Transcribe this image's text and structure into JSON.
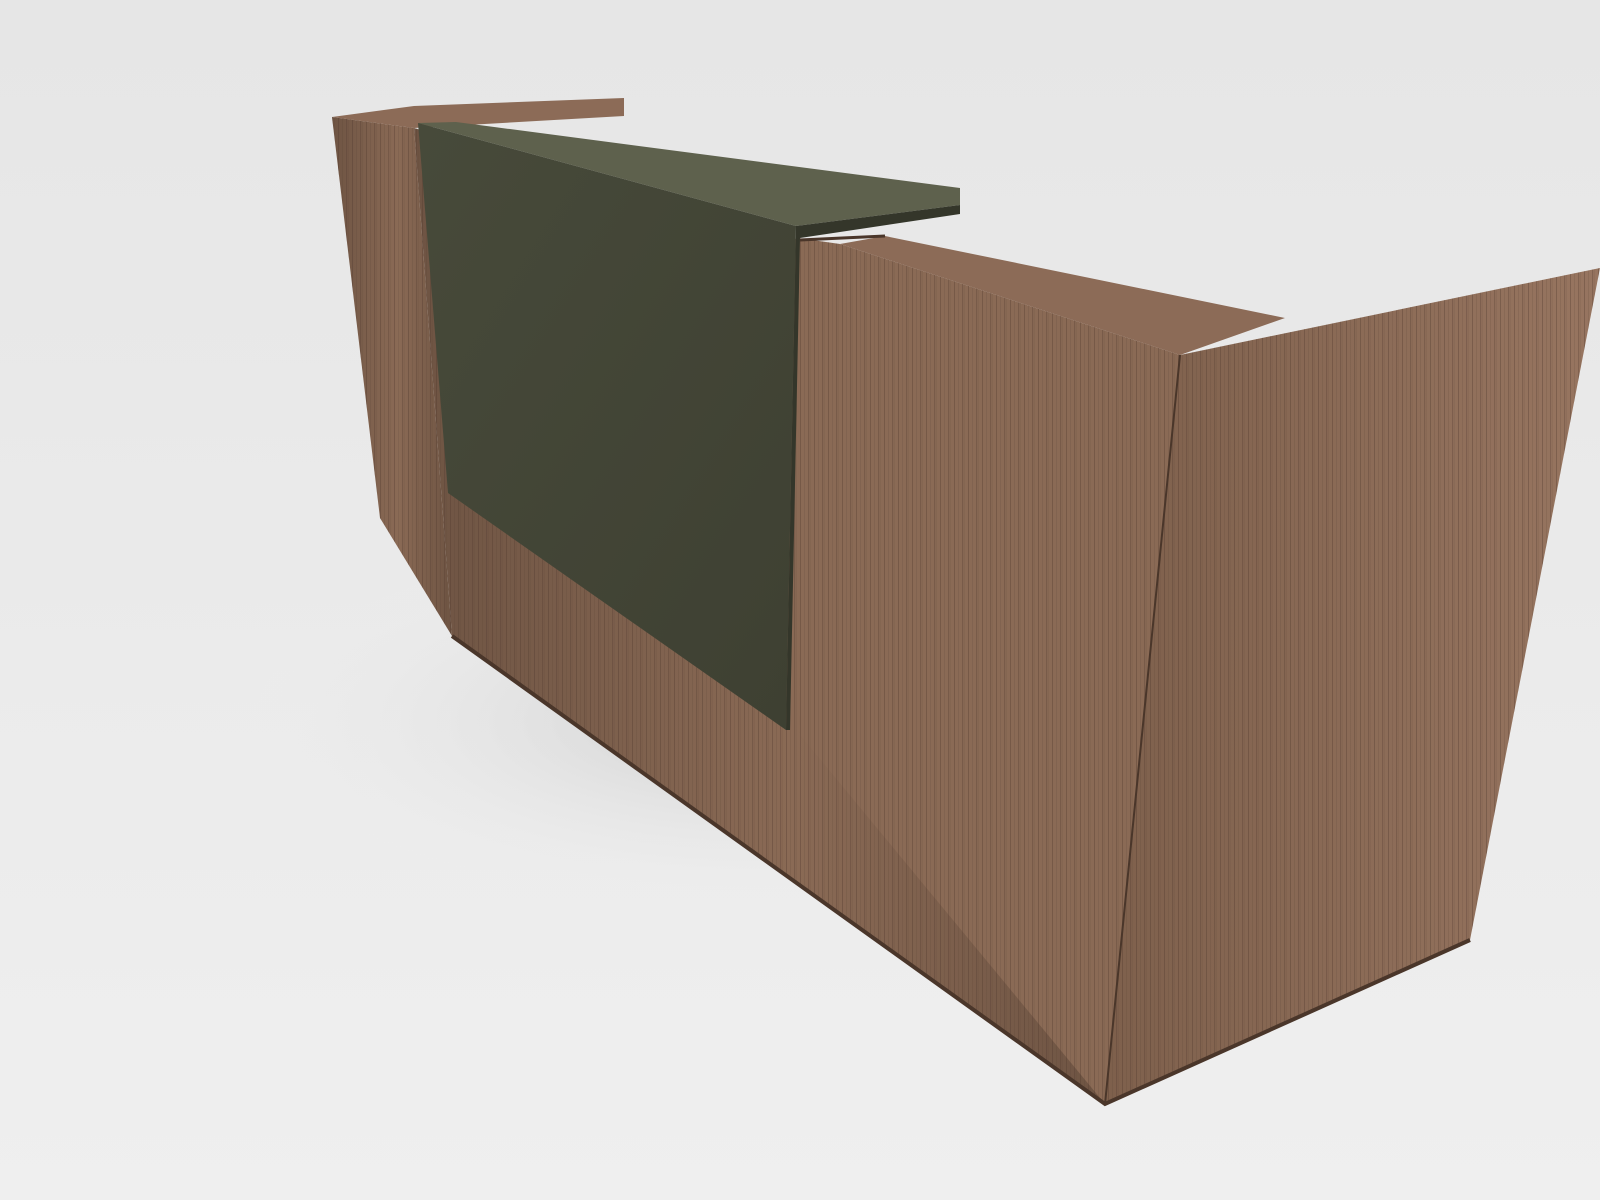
{
  "scene": {
    "subject": "reception-desk",
    "colors": {
      "background_top": "#e6e6e6",
      "background_bottom": "#efefef",
      "wood_front": "#6e5443",
      "wood_front_light": "#8a6a55",
      "wood_side": "#7e604c",
      "wood_side_light": "#977560",
      "wood_top_edge": "#8c6b57",
      "wood_dark_edge": "#4a362a",
      "panel_face": "#474a3a",
      "panel_face_dark": "#3e4032",
      "panel_top": "#5e614d",
      "panel_edge": "#34362a",
      "shadow": "#c7c7c7",
      "grain": "#4f3a2d"
    }
  }
}
